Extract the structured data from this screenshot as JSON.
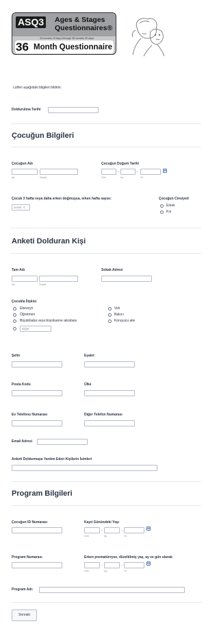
{
  "header": {
    "logo_asq": "ASQ3",
    "logo_line1": "Ages & Stages",
    "logo_line2": "Questionnaires®",
    "logo_range": "34 months 16 days through 38 months 30 days",
    "logo_number": "36",
    "logo_title": "Month Questionnaire"
  },
  "intro": "Lütfen aşağıdaki bilgileri bildirin:",
  "fill_date_label": "Doldurulma Tarihi",
  "child_section": {
    "title": "Çocuğun Bilgileri",
    "name_label": "Çocuğun Adı",
    "first_sub": "Ad",
    "last_sub": "Soyad",
    "dob_label": "Çocuğun Doğum Tarihi",
    "day_sub": "Gün",
    "month_sub": "Ay",
    "year_sub": "Yıl",
    "sep": "-",
    "preterm_label": "Çocuk 3 hafta veya daha erken doğmuşsa, erken hafta sayısı:",
    "preterm_placeholder": "örnek: 4",
    "gender_label": "Çocuğun Cinsiyeti",
    "gender_options": [
      "Erkek",
      "Kız"
    ]
  },
  "filler_section": {
    "title": "Anketi Dolduran Kişi",
    "fullname_label": "Tam Adı",
    "first_sub": "Ad",
    "last_sub": "Soyad",
    "street_label": "Sokak Adresi",
    "relation_label": "Çocukla İlişkisi",
    "relation_left": [
      "Ebeveyn",
      "Öğretmen",
      "Büyükbaba veya büyükanne akrabası"
    ],
    "relation_right": [
      "Veli",
      "Bakıcı",
      "Koruyucu aile"
    ],
    "other_placeholder": "Diğer",
    "city_label": "Şehir",
    "state_label": "Eyalet",
    "zip_label": "Posta Kodu",
    "country_label": "Ülke",
    "home_phone_label": "Ev Telefonu Numarası",
    "other_phone_label": "Diğer Telefon Numarası",
    "email_label": "Email Adresi",
    "helpers_label": "Anketi Doldurmaya Yardım Eden Kişilerin İsimleri"
  },
  "program_section": {
    "title": "Program Bilgileri",
    "child_id_label": "Çocuğun ID Numarası",
    "age_label": "Kayıt Günündeki Yaşı",
    "day_sub": "Gün",
    "month_sub": "Ay",
    "year_sub": "Yıl",
    "program_number_label": "Program Numarası",
    "adjusted_label": "Erken prematüreyse, düzeltilmiş yaş, ay ve gün olarak:",
    "program_name_label": "Program Adı:"
  },
  "next_button": "Sonraki"
}
